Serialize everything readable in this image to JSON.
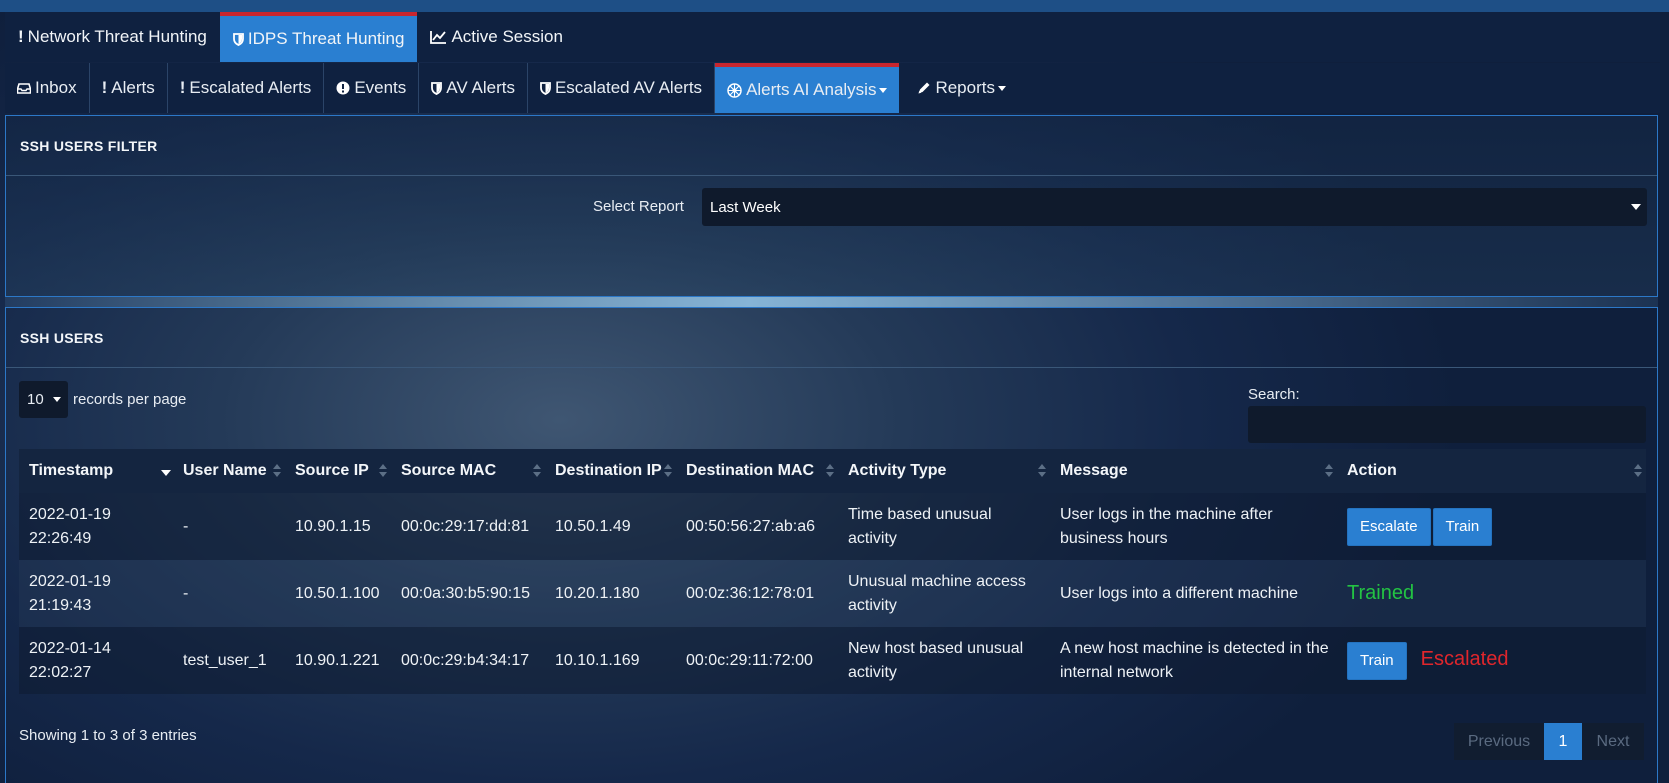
{
  "nav_primary": [
    {
      "label": "Network Threat Hunting",
      "icon": "exclamation-icon",
      "active": false
    },
    {
      "label": "IDPS Threat Hunting",
      "icon": "shield-icon",
      "active": true
    },
    {
      "label": "Active Session",
      "icon": "line-chart-icon",
      "active": false
    }
  ],
  "nav_secondary": [
    {
      "label": "Inbox",
      "icon": "inbox-icon"
    },
    {
      "label": "Alerts",
      "icon": "exclamation-icon"
    },
    {
      "label": "Escalated Alerts",
      "icon": "exclamation-icon"
    },
    {
      "label": "Events",
      "icon": "exclamation-circle-icon"
    },
    {
      "label": "AV Alerts",
      "icon": "shield-icon"
    },
    {
      "label": "Escalated AV Alerts",
      "icon": "shield-icon"
    },
    {
      "label": "Alerts AI Analysis",
      "icon": "ai-icon",
      "active": true,
      "dropdown": true
    },
    {
      "label": "Reports",
      "icon": "pencil-icon",
      "dropdown": true
    }
  ],
  "filter": {
    "title": "SSH USERS FILTER",
    "select_label": "Select Report",
    "select_value": "Last Week"
  },
  "users": {
    "title": "SSH USERS",
    "page_length": "10",
    "page_length_label": "records per page",
    "search_label": "Search:",
    "search_value": "",
    "columns": [
      "Timestamp",
      "User Name",
      "Source IP",
      "Source MAC",
      "Destination IP",
      "Destination MAC",
      "Activity Type",
      "Message",
      "Action"
    ],
    "rows": [
      {
        "timestamp": "2022-01-19 22:26:49",
        "user_name": "-",
        "source_ip": "10.90.1.15",
        "source_mac": "00:0c:29:17:dd:81",
        "destination_ip": "10.50.1.49",
        "destination_mac": "00:50:56:27:ab:a6",
        "activity_type": "Time based unusual activity",
        "message": "User logs in the machine after business hours",
        "escalate_label": "Escalate",
        "train_label": "Train"
      },
      {
        "timestamp": "2022-01-19 21:19:43",
        "user_name": "-",
        "source_ip": "10.50.1.100",
        "source_mac": "00:0a:30:b5:90:15",
        "destination_ip": "10.20.1.180",
        "destination_mac": "00:0z:36:12:78:01",
        "activity_type": "Unusual machine access activity",
        "message": "User logs into a different machine",
        "status": "Trained"
      },
      {
        "timestamp": "2022-01-14 22:02:27",
        "user_name": "test_user_1",
        "source_ip": "10.90.1.221",
        "source_mac": "00:0c:29:b4:34:17",
        "destination_ip": "10.10.1.169",
        "destination_mac": "00:0c:29:11:72:00",
        "activity_type": "New host based unusual activity",
        "message": "A new host machine is detected in the internal network",
        "train_label": "Train",
        "status": "Escalated"
      }
    ],
    "info": "Showing 1 to 3 of 3 entries",
    "pagination": {
      "previous": "Previous",
      "current": "1",
      "next": "Next"
    }
  },
  "colors": {
    "accent": "#2a7fd1",
    "active_tab_border": "#c8262f",
    "trained": "#23c343",
    "escalated": "#e0262c"
  }
}
